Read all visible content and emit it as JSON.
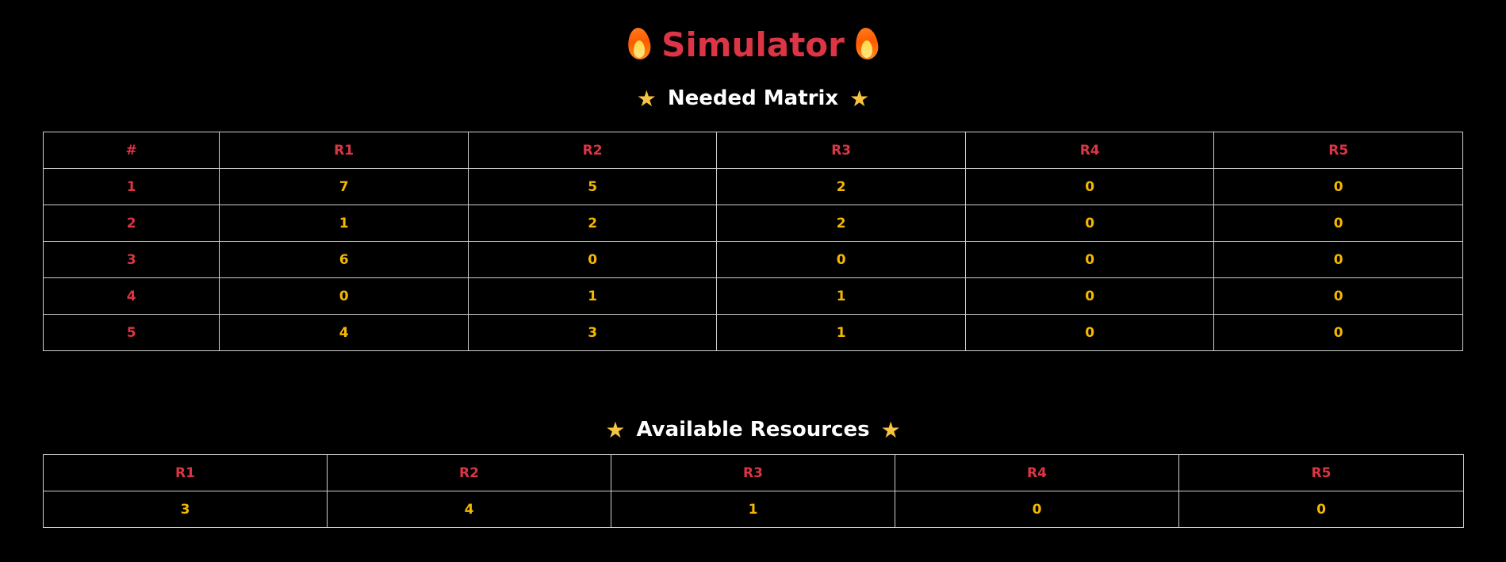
{
  "header": {
    "title": "Simulator",
    "icon": "flame-icon"
  },
  "needed": {
    "title": "Needed Matrix",
    "star": "★",
    "columns": [
      "#",
      "R1",
      "R2",
      "R3",
      "R4",
      "R5"
    ],
    "rows": [
      [
        "1",
        "7",
        "5",
        "2",
        "0",
        "0"
      ],
      [
        "2",
        "1",
        "2",
        "2",
        "0",
        "0"
      ],
      [
        "3",
        "6",
        "0",
        "0",
        "0",
        "0"
      ],
      [
        "4",
        "0",
        "1",
        "1",
        "0",
        "0"
      ],
      [
        "5",
        "4",
        "3",
        "1",
        "0",
        "0"
      ]
    ]
  },
  "available": {
    "title": "Available Resources",
    "star": "★",
    "columns": [
      "R1",
      "R2",
      "R3",
      "R4",
      "R5"
    ],
    "values": [
      "3",
      "4",
      "1",
      "0",
      "0"
    ]
  },
  "colors": {
    "background": "#000000",
    "title": "#dc3545",
    "header_cell": "#dc3545",
    "value_cell": "#f5b800",
    "star": "#f6c343",
    "border": "#cfcfcf"
  }
}
